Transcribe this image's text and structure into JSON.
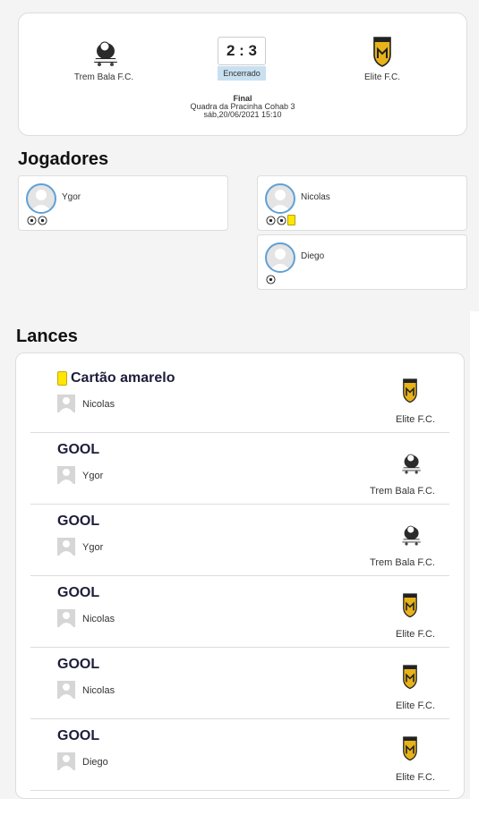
{
  "match": {
    "home_team": "Trem Bala F.C.",
    "away_team": "Elite F.C.",
    "score": "2 : 3",
    "status": "Encerrado",
    "round": "Final",
    "venue": "Quadra da Pracinha Cohab 3",
    "datetime": "sáb,20/06/2021 15:10"
  },
  "players_section": {
    "title": "Jogadores",
    "home": [
      {
        "name": "Ygor",
        "events": [
          "goal",
          "goal"
        ]
      }
    ],
    "away": [
      {
        "name": "Nicolas",
        "events": [
          "goal",
          "goal",
          "yellow-card"
        ]
      },
      {
        "name": "Diego",
        "events": [
          "goal"
        ]
      }
    ]
  },
  "lances_section": {
    "title": "Lances",
    "items": [
      {
        "type": "Cartão amarelo",
        "icon": "yellow-card-icon",
        "player": "Nicolas",
        "team": "Elite F.C."
      },
      {
        "type": "GOOL",
        "player": "Ygor",
        "team": "Trem Bala F.C."
      },
      {
        "type": "GOOL",
        "player": "Ygor",
        "team": "Trem Bala F.C."
      },
      {
        "type": "GOOL",
        "player": "Nicolas",
        "team": "Elite F.C."
      },
      {
        "type": "GOOL",
        "player": "Nicolas",
        "team": "Elite F.C."
      },
      {
        "type": "GOOL",
        "player": "Diego",
        "team": "Elite F.C."
      }
    ]
  },
  "colors": {
    "status_bg": "#c9e0f1",
    "avatar_ring": "#5fa0d6",
    "yellow_card": "#ffe600",
    "elite_crest": "#e8b21a"
  }
}
